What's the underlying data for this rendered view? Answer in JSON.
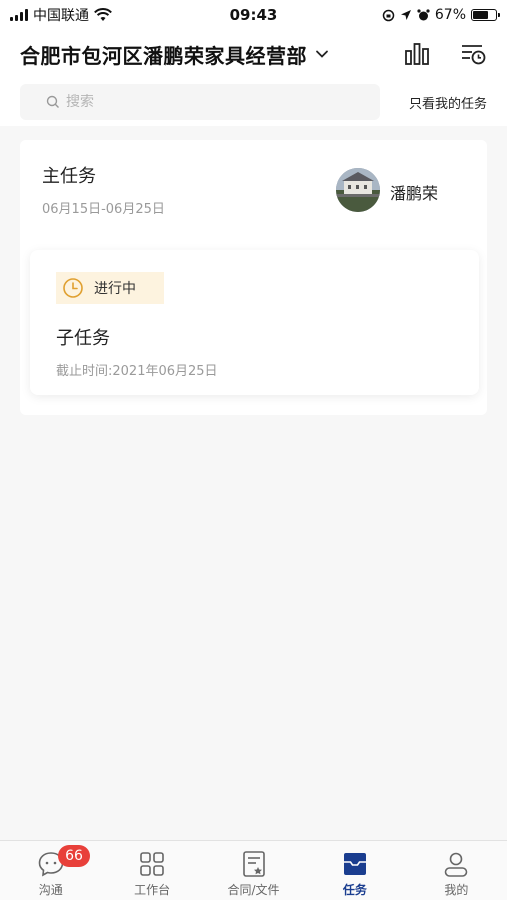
{
  "status_bar": {
    "carrier": "中国联通",
    "time": "09:43",
    "battery_percent": "67%",
    "battery_level": 0.67
  },
  "header": {
    "title": "合肥市包河区潘鹏荣家具经营部",
    "chevron_icon": "chevron-down-icon",
    "actions": [
      "bar-chart-icon",
      "filter-clock-icon"
    ]
  },
  "search": {
    "placeholder": "搜索",
    "value": "",
    "only_mine_label": "只看我的任务"
  },
  "main_task": {
    "title": "主任务",
    "date_range": "06月15日-06月25日",
    "owner": "潘鹏荣"
  },
  "sub_task": {
    "status": "进行中",
    "title": "子任务",
    "deadline": "截止时间:2021年06月25日"
  },
  "tabs": [
    {
      "label": "沟通",
      "icon": "chat-bubble-icon",
      "badge": "66",
      "active": false
    },
    {
      "label": "工作台",
      "icon": "grid-icon",
      "active": false
    },
    {
      "label": "合同/文件",
      "icon": "document-icon",
      "active": false
    },
    {
      "label": "任务",
      "icon": "inbox-tray-icon",
      "active": true
    },
    {
      "label": "我的",
      "icon": "person-icon",
      "active": false
    }
  ],
  "colors": {
    "accent": "#1a3d8f",
    "badge_red": "#e8403a",
    "status_bg": "#fdf3df",
    "status_icon": "#e0a030"
  }
}
